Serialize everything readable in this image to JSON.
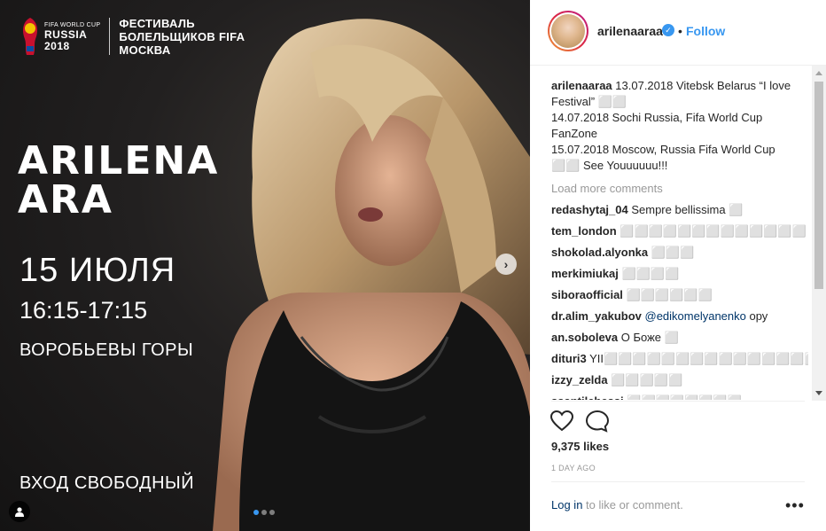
{
  "poster": {
    "logo": {
      "cup_line1": "FIFA WORLD CUP",
      "cup_line2": "RUSSIA",
      "cup_line3": "2018",
      "festival_line1": "ФЕСТИВАЛЬ",
      "festival_line2": "БОЛЕЛЬЩИКОВ FIFA",
      "festival_line3": "МОСКВА"
    },
    "artist_line1": "ARILENA",
    "artist_line2": "ARA",
    "date": "15 ИЮЛЯ",
    "time": "16:15-17:15",
    "place": "ВОРОБЬЕВЫ ГОРЫ",
    "entry": "ВХОД СВОБОДНЫЙ",
    "carousel": {
      "total": 3,
      "active": 1
    },
    "next_arrow_icon": "chevron-right-icon",
    "user_tag_icon": "user-icon"
  },
  "header": {
    "username": "arilenaaraa",
    "verified_icon": "verified-icon",
    "separator": "•",
    "follow_label": "Follow"
  },
  "caption": {
    "username": "arilenaaraa",
    "line1": " 13.07.2018 Vitebsk Belarus “I love Festival” ",
    "line2": "14.07.2018 Sochi Russia, Fifa World Cup FanZone",
    "line3": "15.07.2018 Moscow, Russia Fifa World Cup",
    "line4": " See Youuuuuu!!!",
    "emoji1": "⬜⬜",
    "emoji2": "⬜⬜"
  },
  "load_more": "Load more comments",
  "comments": [
    {
      "user": "redashytaj_04",
      "text": " Sempre bellissima ⬜"
    },
    {
      "user": "tem_london",
      "text": " ⬜⬜⬜⬜⬜⬜⬜⬜⬜⬜⬜⬜⬜"
    },
    {
      "user": "shokolad.alyonka",
      "text": " ⬜⬜⬜"
    },
    {
      "user": "merkimiukaj",
      "text": " ⬜⬜⬜⬜"
    },
    {
      "user": "siboraofficial",
      "text": " ⬜⬜⬜⬜⬜⬜"
    },
    {
      "user": "dr.alim_yakubov",
      "mention": " @edikomelyanenko",
      "text": " ору"
    },
    {
      "user": "an.soboleva",
      "text": " О Боже ⬜"
    },
    {
      "user": "dituri3",
      "text": " YII⬜⬜⬜⬜⬜⬜⬜⬜⬜⬜⬜⬜⬜⬜⬜⬜⬜⬜"
    },
    {
      "user": "izzy_zelda",
      "text": " ⬜⬜⬜⬜⬜"
    },
    {
      "user": "ssantilchessi",
      "text": " ⬜⬜⬜⬜⬜⬜⬜⬜"
    }
  ],
  "likes": "9,375 likes",
  "timestamp": "1 DAY AGO",
  "login": {
    "link": "Log in",
    "rest": " to like or comment."
  },
  "more_label": "•••",
  "colors": {
    "accent": "#3897f0",
    "text": "#262626",
    "muted": "#999999",
    "link_dark": "#003569"
  }
}
